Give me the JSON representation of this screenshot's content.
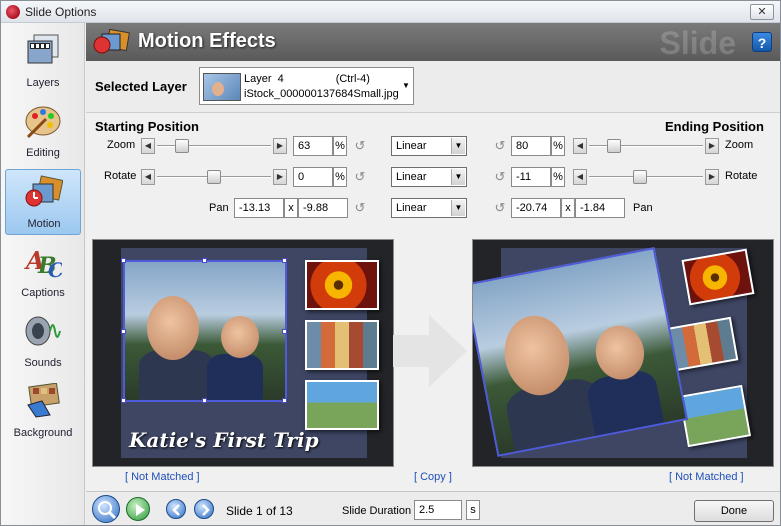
{
  "window": {
    "title": "Slide Options",
    "close_label": "✕"
  },
  "sidebar": {
    "items": [
      {
        "label": "Layers",
        "icon": "layers-icon"
      },
      {
        "label": "Editing",
        "icon": "palette-icon"
      },
      {
        "label": "Motion",
        "icon": "motion-icon",
        "active": true
      },
      {
        "label": "Captions",
        "icon": "captions-icon"
      },
      {
        "label": "Sounds",
        "icon": "speaker-icon"
      },
      {
        "label": "Background",
        "icon": "background-icon"
      }
    ]
  },
  "header": {
    "title": "Motion Effects",
    "watermark": "Slide",
    "help_label": "?"
  },
  "layer": {
    "label": "Selected Layer",
    "line1": "Layer  4                 (Ctrl-4)",
    "line2": "iStock_000000137684Small.jpg"
  },
  "start": {
    "heading": "Starting Position",
    "zoom_label": "Zoom",
    "zoom_value": "63",
    "zoom_fraction": 0.18,
    "rotate_label": "Rotate",
    "rotate_value": "0",
    "rotate_fraction": 0.5,
    "pan_label": "Pan",
    "pan_x": "-13.13",
    "pan_y": "-9.88",
    "percent": "%",
    "times": "x"
  },
  "motion": {
    "zoom": "Linear",
    "rotate": "Linear",
    "pan": "Linear"
  },
  "end": {
    "heading": "Ending Position",
    "zoom_label": "Zoom",
    "zoom_value": "80",
    "zoom_fraction": 0.18,
    "rotate_label": "Rotate",
    "rotate_value": "-11",
    "rotate_fraction": 0.44,
    "pan_label": "Pan",
    "pan_x": "-20.74",
    "pan_y": "-1.84",
    "percent": "%",
    "times": "x"
  },
  "preview": {
    "caption": "Katie's First Trip",
    "left_link": "[ Not Matched ]",
    "center_link": "[ Copy ]",
    "right_link": "[ Not Matched ]"
  },
  "bottom": {
    "slide_info": "Slide 1 of 13",
    "duration_label": "Slide Duration",
    "duration_value": "2.5",
    "duration_unit": "s",
    "done_label": "Done"
  },
  "colors": {
    "accent": "#4f5bd8",
    "header": "#6a6a6a",
    "link": "#1f4fb8"
  }
}
